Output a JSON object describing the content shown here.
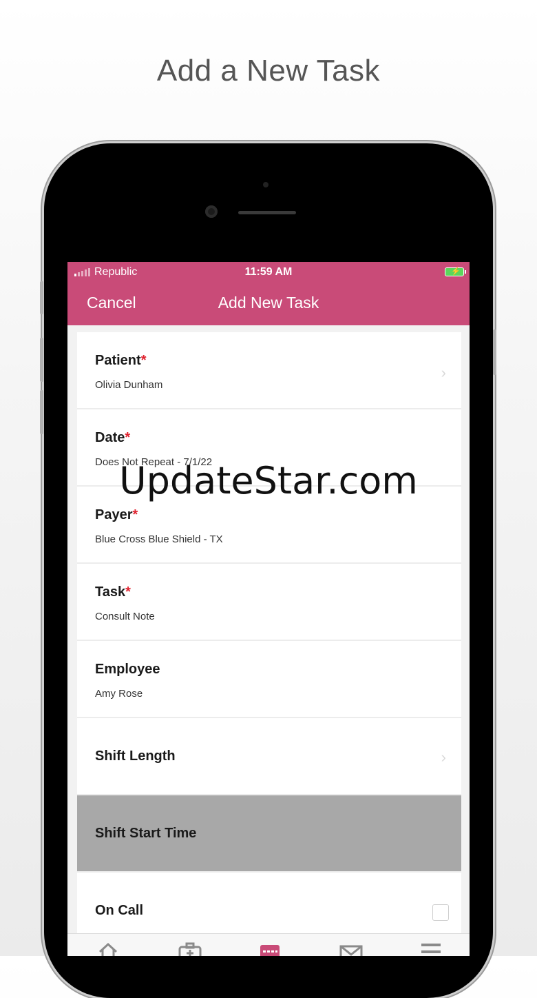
{
  "headline": "Add a New Task",
  "status_bar": {
    "carrier": "Republic",
    "time": "11:59 AM"
  },
  "nav": {
    "cancel_label": "Cancel",
    "title": "Add New Task"
  },
  "form": {
    "rows": [
      {
        "label": "Patient",
        "required": "*",
        "value": "Olivia Dunham"
      },
      {
        "label": "Date",
        "required": "*",
        "value": "Does Not Repeat - 7/1/22"
      },
      {
        "label": "Payer",
        "required": "*",
        "value": "Blue Cross Blue Shield - TX"
      },
      {
        "label": "Task",
        "required": "*",
        "value": "Consult Note"
      },
      {
        "label": "Employee",
        "value": "Amy Rose"
      },
      {
        "label": "Shift Length"
      },
      {
        "label": "Shift Start Time"
      },
      {
        "label": "On Call"
      }
    ]
  },
  "watermark": "UpdateStar.com",
  "colors": {
    "accent": "#c94b78",
    "required": "#e0222e",
    "highlight_row": "#a8a8a8"
  },
  "tabbar": {
    "icons": [
      "home-icon",
      "briefcase-icon",
      "calendar-icon",
      "mail-icon",
      "menu-icon"
    ]
  }
}
